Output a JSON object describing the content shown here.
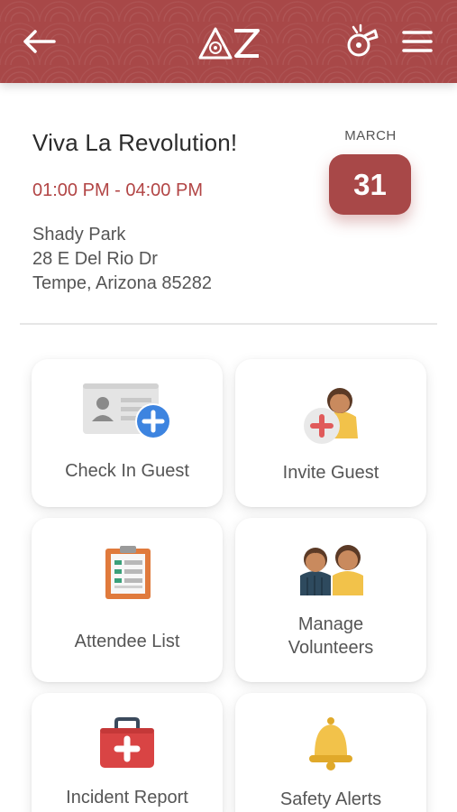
{
  "header": {
    "brand_color": "#a84848",
    "back_icon": "back-arrow-icon",
    "logo_text": "AZ",
    "whistle_icon": "whistle-icon",
    "menu_icon": "hamburger-menu-icon"
  },
  "event": {
    "title": "Viva La Revolution!",
    "time": "01:00 PM - 04:00 PM",
    "venue": "Shady Park",
    "street": "28 E Del Rio Dr",
    "city": "Tempe, Arizona 85282",
    "month": "MARCH",
    "day": "31"
  },
  "tiles": [
    {
      "label": "Check In Guest",
      "icon": "id-card-plus-icon"
    },
    {
      "label": "Invite Guest",
      "icon": "person-plus-icon"
    },
    {
      "label": "Attendee List",
      "icon": "clipboard-list-icon"
    },
    {
      "label_line1": "Manage",
      "label_line2": "Volunteers",
      "icon": "volunteers-icon"
    },
    {
      "label": "Incident Report",
      "icon": "first-aid-kit-icon"
    },
    {
      "label": "Safety Alerts",
      "icon": "bell-icon"
    }
  ]
}
